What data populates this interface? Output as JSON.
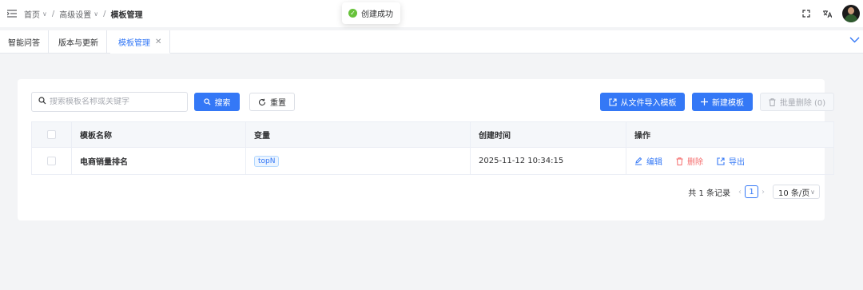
{
  "header": {
    "breadcrumb": [
      {
        "label": "首页",
        "has_dropdown": true
      },
      {
        "label": "高级设置",
        "has_dropdown": true
      },
      {
        "label": "模板管理",
        "has_dropdown": false
      }
    ],
    "separator": "/",
    "icons": [
      "menu-fold-icon",
      "fullscreen-icon",
      "translate-icon"
    ]
  },
  "toast": {
    "message": "创建成功",
    "type": "success"
  },
  "tabs": [
    {
      "label": "智能问答",
      "active": false
    },
    {
      "label": "版本与更新",
      "active": false
    },
    {
      "label": "模板管理",
      "active": true,
      "closable": true
    }
  ],
  "toolbar": {
    "search_placeholder": "搜索模板名称或关键字",
    "search_value": "",
    "search_label": "搜索",
    "reset_label": "重置",
    "import_label": "从文件导入模板",
    "new_label": "新建模板",
    "batch_delete_label": "批量删除 (0)"
  },
  "table": {
    "columns": [
      "模板名称",
      "变量",
      "创建时间",
      "操作"
    ],
    "rows": [
      {
        "name": "电商销量排名",
        "variables": [
          "topN"
        ],
        "created_at": "2025-11-12 10:34:15",
        "actions": [
          "编辑",
          "删除",
          "导出"
        ]
      }
    ]
  },
  "pagination": {
    "total_text": "共 1 条记录",
    "current_page": "1",
    "page_size": "10 条/页"
  },
  "colors": {
    "primary": "#3478f6",
    "danger": "#f56c6c",
    "success": "#67c23a",
    "background": "#f3f4f6"
  }
}
